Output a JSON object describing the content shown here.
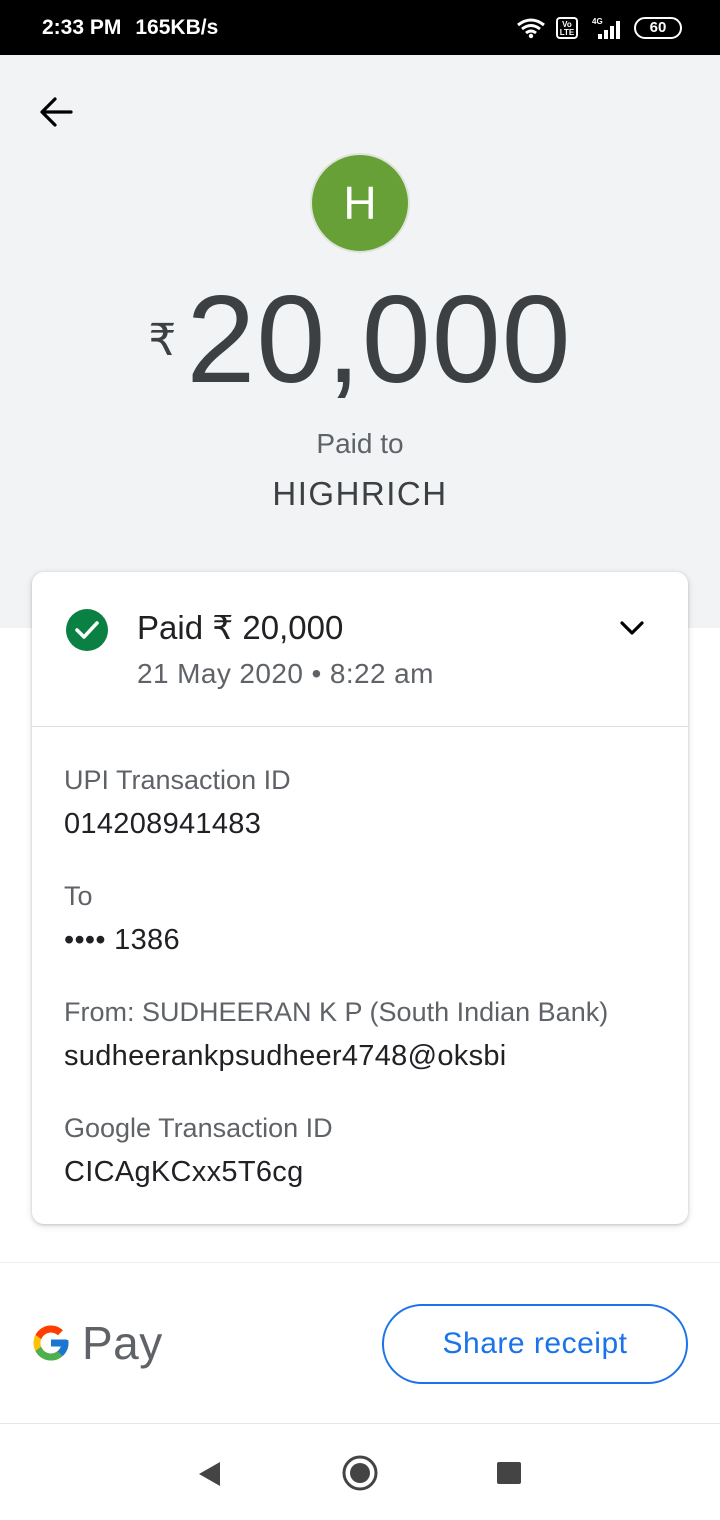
{
  "status_bar": {
    "time": "2:33 PM",
    "speed": "165KB/s",
    "lte_label": "Vo LTE",
    "network_type": "4G",
    "battery": "60"
  },
  "header": {
    "avatar_initial": "H",
    "avatar_color": "#68a038",
    "currency_symbol": "₹",
    "amount": "20,000",
    "paid_to_label": "Paid to",
    "payee_name": "HIGHRICH"
  },
  "card": {
    "status_title": "Paid ₹ 20,000",
    "status_color": "#0b8043",
    "date_time": "21 May 2020 • 8:22 am",
    "details": [
      {
        "label": "UPI Transaction ID",
        "value": "014208941483"
      },
      {
        "label": "To",
        "value": "•••• 1386"
      },
      {
        "label": "From: SUDHEERAN K P (South Indian Bank)",
        "value": "sudheerankpsudheer4748@oksbi"
      },
      {
        "label": "Google Transaction ID",
        "value": "CICAgKCxx5T6cg"
      }
    ]
  },
  "footer": {
    "brand_text": "Pay",
    "share_button_label": "Share receipt",
    "accent_color": "#1a73e8"
  }
}
